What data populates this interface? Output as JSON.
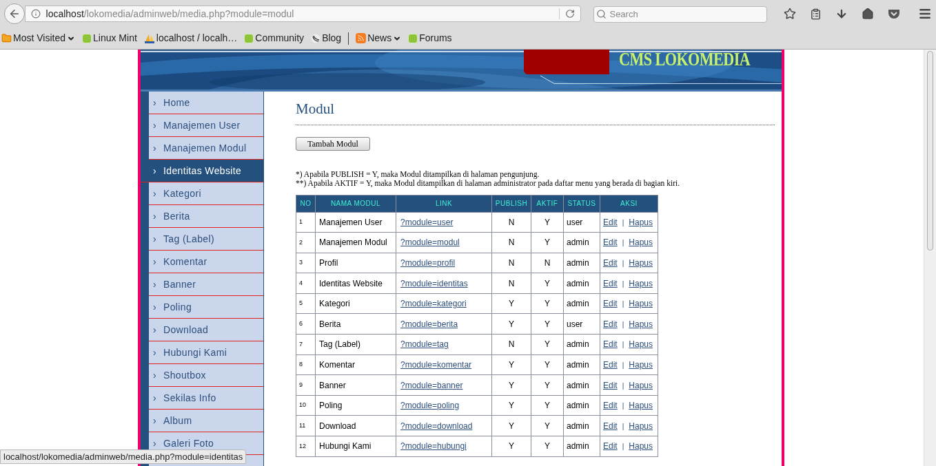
{
  "browser": {
    "url_host": "localhost",
    "url_path": "/lokomedia/adminweb/media.php?module=modul",
    "search_placeholder": "Search"
  },
  "bookmarks": [
    {
      "label": "Most Visited",
      "kind": "folder",
      "dropdown": true
    },
    {
      "label": "Linux Mint",
      "kind": "mint",
      "dropdown": false
    },
    {
      "label": "localhost / localh…",
      "kind": "pma",
      "dropdown": false
    },
    {
      "label": "Community",
      "kind": "mint",
      "dropdown": false
    },
    {
      "label": "Blog",
      "kind": "blog",
      "dropdown": false
    },
    {
      "label": "News",
      "kind": "rss",
      "dropdown": true,
      "separator_before": true
    },
    {
      "label": "Forums",
      "kind": "mint",
      "dropdown": false
    }
  ],
  "header": {
    "title": "CMS LOKOMEDIA"
  },
  "sidebar": {
    "marker": "›",
    "items": [
      {
        "label": "Home",
        "selected": false
      },
      {
        "label": "Manajemen User",
        "selected": false
      },
      {
        "label": "Manajemen Modul",
        "selected": false
      },
      {
        "label": "Identitas Website",
        "selected": true
      },
      {
        "label": "Kategori",
        "selected": false
      },
      {
        "label": "Berita",
        "selected": false
      },
      {
        "label": "Tag (Label)",
        "selected": false
      },
      {
        "label": "Komentar",
        "selected": false
      },
      {
        "label": "Banner",
        "selected": false
      },
      {
        "label": "Poling",
        "selected": false
      },
      {
        "label": "Download",
        "selected": false
      },
      {
        "label": "Hubungi Kami",
        "selected": false
      },
      {
        "label": "Shoutbox",
        "selected": false
      },
      {
        "label": "Sekilas Info",
        "selected": false
      },
      {
        "label": "Album",
        "selected": false
      },
      {
        "label": "Galeri Foto",
        "selected": false
      }
    ]
  },
  "content": {
    "title": "Modul",
    "add_button": "Tambah Modul",
    "notes": [
      "*) Apabila PUBLISH = Y, maka Modul ditampilkan di halaman pengunjung.",
      "**) Apabila AKTIF = Y, maka Modul ditampilkan di halaman administrator pada daftar menu yang berada di bagian kiri."
    ],
    "table": {
      "columns": [
        "NO",
        "NAMA MODUL",
        "LINK",
        "PUBLISH",
        "AKTIF",
        "STATUS",
        "AKSI"
      ],
      "separator": "|",
      "rows": [
        {
          "no": "1",
          "name": "Manajemen User",
          "link": "?module=user",
          "publish": "N",
          "aktif": "Y",
          "status": "user",
          "edit": "Edit",
          "delete": "Hapus"
        },
        {
          "no": "2",
          "name": "Manajemen Modul",
          "link": "?module=modul",
          "publish": "N",
          "aktif": "Y",
          "status": "admin",
          "edit": "Edit",
          "delete": "Hapus"
        },
        {
          "no": "3",
          "name": "Profil",
          "link": "?module=profil",
          "publish": "N",
          "aktif": "N",
          "status": "admin",
          "edit": "Edit",
          "delete": "Hapus"
        },
        {
          "no": "4",
          "name": "Identitas Website",
          "link": "?module=identitas",
          "publish": "N",
          "aktif": "Y",
          "status": "admin",
          "edit": "Edit",
          "delete": "Hapus"
        },
        {
          "no": "5",
          "name": "Kategori",
          "link": "?module=kategori",
          "publish": "Y",
          "aktif": "Y",
          "status": "admin",
          "edit": "Edit",
          "delete": "Hapus"
        },
        {
          "no": "6",
          "name": "Berita",
          "link": "?module=berita",
          "publish": "Y",
          "aktif": "Y",
          "status": "user",
          "edit": "Edit",
          "delete": "Hapus"
        },
        {
          "no": "7",
          "name": "Tag (Label)",
          "link": "?module=tag",
          "publish": "N",
          "aktif": "Y",
          "status": "admin",
          "edit": "Edit",
          "delete": "Hapus"
        },
        {
          "no": "8",
          "name": "Komentar",
          "link": "?module=komentar",
          "publish": "Y",
          "aktif": "Y",
          "status": "admin",
          "edit": "Edit",
          "delete": "Hapus"
        },
        {
          "no": "9",
          "name": "Banner",
          "link": "?module=banner",
          "publish": "Y",
          "aktif": "Y",
          "status": "admin",
          "edit": "Edit",
          "delete": "Hapus"
        },
        {
          "no": "10",
          "name": "Poling",
          "link": "?module=poling",
          "publish": "Y",
          "aktif": "Y",
          "status": "admin",
          "edit": "Edit",
          "delete": "Hapus"
        },
        {
          "no": "11",
          "name": "Download",
          "link": "?module=download",
          "publish": "Y",
          "aktif": "Y",
          "status": "admin",
          "edit": "Edit",
          "delete": "Hapus"
        },
        {
          "no": "12",
          "name": "Hubungi Kami",
          "link": "?module=hubungi",
          "publish": "Y",
          "aktif": "Y",
          "status": "admin",
          "edit": "Edit",
          "delete": "Hapus"
        }
      ]
    }
  },
  "status_bar": {
    "text": "localhost/lokomedia/adminweb/media.php?module=identitas"
  }
}
